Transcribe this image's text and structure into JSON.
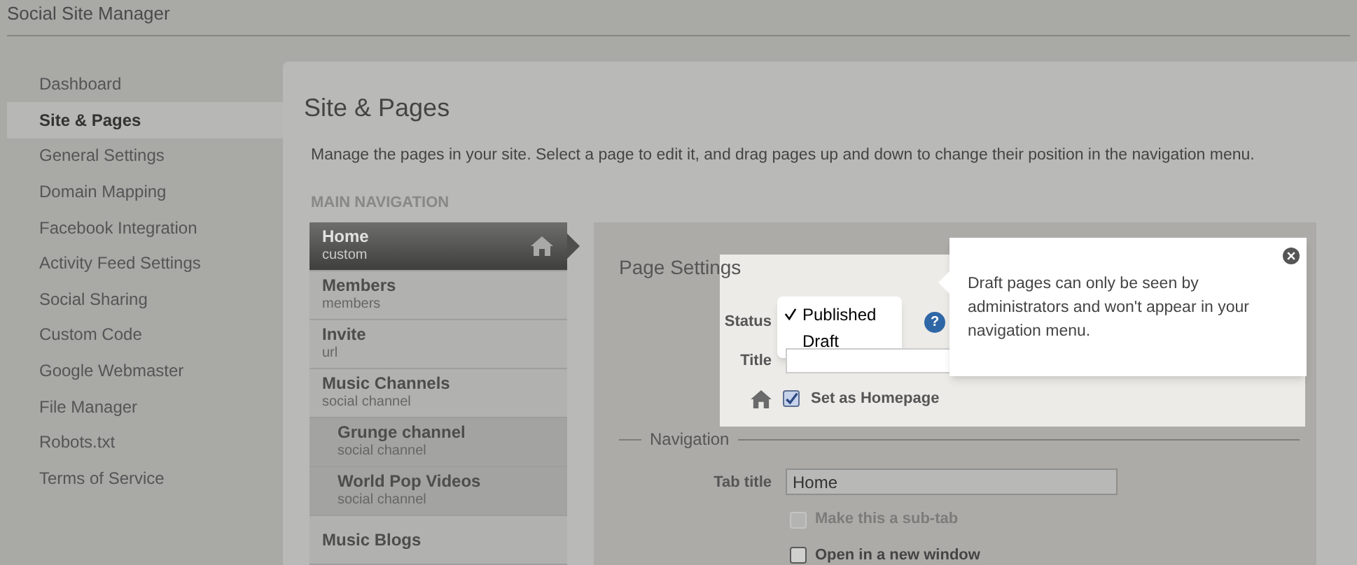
{
  "app_title": "Social Site Manager",
  "sidebar": {
    "items": [
      {
        "label": "Dashboard",
        "selected": false
      },
      {
        "label": "Site & Pages",
        "selected": true
      },
      {
        "label": "General Settings",
        "selected": false
      },
      {
        "label": "Domain Mapping",
        "selected": false
      },
      {
        "label": "Facebook Integration",
        "selected": false
      },
      {
        "label": "Activity Feed Settings",
        "selected": false
      },
      {
        "label": "Social Sharing",
        "selected": false
      },
      {
        "label": "Custom Code",
        "selected": false
      },
      {
        "label": "Google Webmaster",
        "selected": false
      },
      {
        "label": "File Manager",
        "selected": false
      },
      {
        "label": "Robots.txt",
        "selected": false
      },
      {
        "label": "Terms of Service",
        "selected": false
      }
    ]
  },
  "page": {
    "title": "Site & Pages",
    "description": "Manage the pages in your site. Select a page to edit it, and drag pages up and down to change their position in the navigation menu.",
    "section_label": "MAIN NAVIGATION"
  },
  "navigation": [
    {
      "name": "Home",
      "type": "custom",
      "selected": true,
      "homepage": true
    },
    {
      "name": "Members",
      "type": "members",
      "selected": false,
      "homepage": false
    },
    {
      "name": "Invite",
      "type": "url",
      "selected": false,
      "homepage": false
    },
    {
      "name": "Music Channels",
      "type": "social channel",
      "selected": false,
      "homepage": false,
      "children": [
        {
          "name": "Grunge channel",
          "type": "social channel",
          "selected": false,
          "homepage": false
        },
        {
          "name": "World Pop Videos",
          "type": "social channel",
          "selected": false,
          "homepage": false
        }
      ]
    },
    {
      "name": "Music Blogs",
      "selected": false,
      "homepage": false
    }
  ],
  "settings": {
    "heading": "Page Settings",
    "status_label": "Status",
    "status_options": [
      {
        "label": "Published",
        "selected": true
      },
      {
        "label": "Draft",
        "selected": false
      }
    ],
    "help_icon": "?",
    "title_label": "Title",
    "homepage": {
      "label": "Set as Homepage",
      "checked": true
    },
    "navigation_legend": "Navigation",
    "tab_title_label": "Tab title",
    "tab_title_value": "Home",
    "options": [
      {
        "label": "Make this a sub-tab",
        "checked": false,
        "disabled": true
      },
      {
        "label": "Open in a new window",
        "checked": false,
        "disabled": false
      }
    ]
  },
  "tooltip": {
    "text": "Draft pages can only be seen by administrators and won't appear in your navigation menu."
  }
}
